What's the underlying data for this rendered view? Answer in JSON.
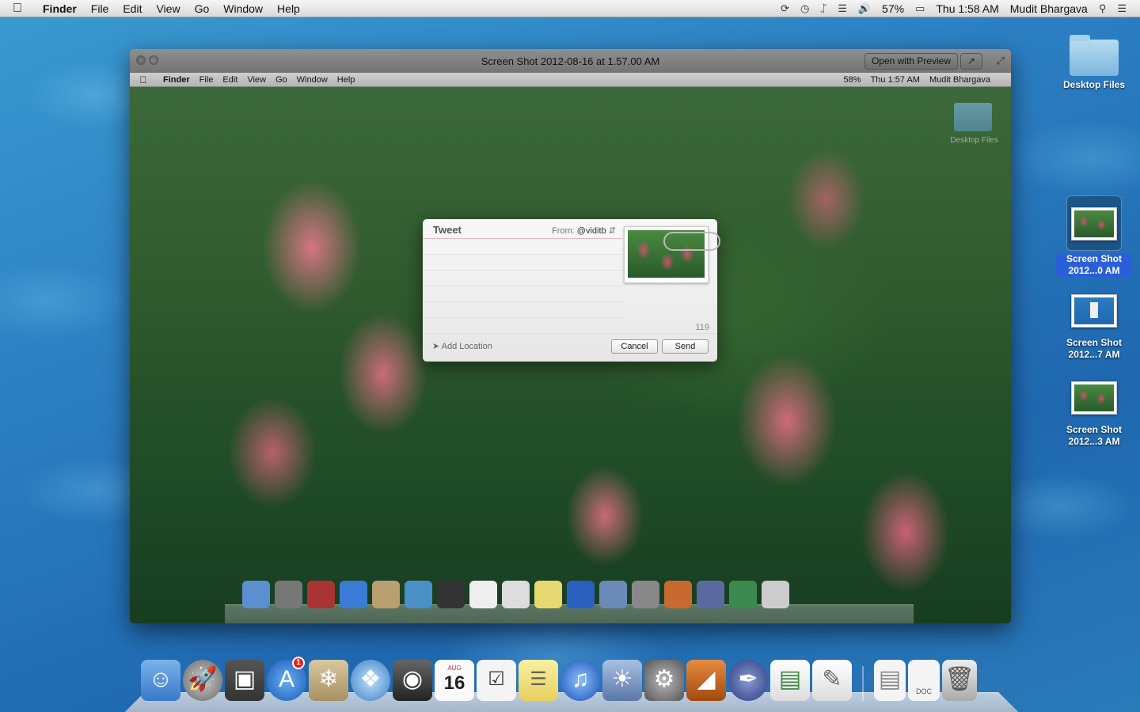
{
  "menubar": {
    "app_name": "Finder",
    "menus": [
      "File",
      "Edit",
      "View",
      "Go",
      "Window",
      "Help"
    ],
    "battery_percent": "57%",
    "clock": "Thu 1:58 AM",
    "user": "Mudit Bhargava"
  },
  "quicklook": {
    "title": "Screen Shot 2012-08-16 at 1.57.00 AM",
    "open_button": "Open with Preview",
    "inner_menubar": {
      "app_name": "Finder",
      "menus": [
        "File",
        "Edit",
        "View",
        "Go",
        "Window",
        "Help"
      ],
      "battery_percent": "58%",
      "clock": "Thu 1:57 AM",
      "user": "Mudit Bhargava"
    },
    "inner_folder_label": "Desktop Files"
  },
  "tweet": {
    "title": "Tweet",
    "from_label": "From:",
    "from_user": "@viditb",
    "char_count": "119",
    "add_location": "Add Location",
    "cancel": "Cancel",
    "send": "Send"
  },
  "desktop": {
    "items": [
      {
        "label": "Desktop Files",
        "type": "folder"
      },
      {
        "label_line1": "Screen Shot",
        "label_line2": "2012...0 AM",
        "selected": true
      },
      {
        "label_line1": "Screen Shot",
        "label_line2": "2012...7 AM",
        "selected": false
      },
      {
        "label_line1": "Screen Shot",
        "label_line2": "2012...3 AM",
        "selected": false
      }
    ]
  },
  "dock": {
    "calendar_day": "16",
    "calendar_month": "AUG",
    "appstore_badge": "1",
    "doc_label": "DOC",
    "items": [
      "finder-icon",
      "launchpad-icon",
      "photo-booth-icon",
      "app-store-icon",
      "preview-icon",
      "safari-icon",
      "facetime-icon",
      "calendar-icon",
      "reminders-icon",
      "notes-icon",
      "itunes-icon",
      "iphoto-icon",
      "system-preferences-icon",
      "keynote-icon",
      "pages-icon",
      "numbers-icon",
      "textedit-icon",
      "document-icon",
      "doc-file-icon",
      "trash-icon"
    ]
  },
  "colors": {
    "selection_blue": "#2a5fd8",
    "badge_red": "#e02020"
  }
}
